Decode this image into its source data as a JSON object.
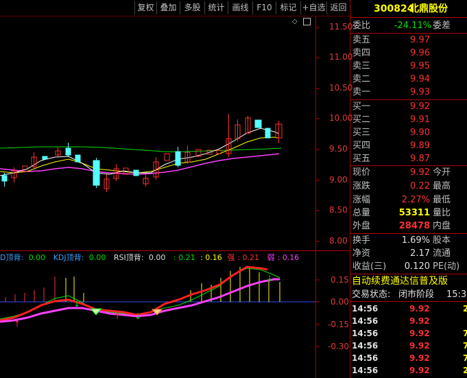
{
  "toolbar": {
    "buttons": [
      "复权",
      "叠加",
      "多股",
      "统计",
      "画线",
      "F10",
      "标记",
      "+自选",
      "返回"
    ]
  },
  "price_axis": {
    "labels": [
      "11.50",
      "11.00",
      "10.50",
      "10.00",
      "9.50",
      "9.00",
      "8.50",
      "8.00"
    ]
  },
  "indicator_axis": {
    "labels": [
      "0.15",
      "0.00",
      "-0.15",
      "-0.30"
    ]
  },
  "indicator": {
    "d_top_label": "D顶背:",
    "d_top_value": "0.00",
    "kdj_label": "KDJ顶背:",
    "kdj_value": "0.00",
    "rsi_label": "RSI顶背:",
    "rsi_value": "0.00",
    "v1": ": 0.21",
    "v2": ": 0.16",
    "strong_label": "强",
    "strong_value": ": 0.21",
    "weak_label": "弱",
    "weak_value": ": 0.16"
  },
  "stock": {
    "code": "300824",
    "name": "北鼎股份"
  },
  "order_book": {
    "ratio_label": "委比",
    "ratio_value": "-24.11%",
    "diff_label": "委差",
    "asks": [
      {
        "label": "卖五",
        "price": "9.97"
      },
      {
        "label": "卖四",
        "price": "9.96"
      },
      {
        "label": "卖三",
        "price": "9.95"
      },
      {
        "label": "卖二",
        "price": "9.94"
      },
      {
        "label": "卖一",
        "price": "9.93"
      }
    ],
    "bids": [
      {
        "label": "买一",
        "price": "9.92"
      },
      {
        "label": "买二",
        "price": "9.91"
      },
      {
        "label": "买三",
        "price": "9.90"
      },
      {
        "label": "买四",
        "price": "9.89"
      },
      {
        "label": "买五",
        "price": "9.87"
      }
    ]
  },
  "quote": {
    "rows": [
      {
        "label": "现价",
        "value": "9.92",
        "label2": "今开",
        "color": "red"
      },
      {
        "label": "涨跌",
        "value": "0.22",
        "label2": "最高",
        "color": "red"
      },
      {
        "label": "涨幅",
        "value": "2.27%",
        "label2": "最低",
        "color": "red"
      },
      {
        "label": "总量",
        "value": "53311",
        "label2": "量比",
        "color": "yel"
      },
      {
        "label": "外盘",
        "value": "28478",
        "label2": "内盘",
        "color": "red"
      }
    ],
    "rows2": [
      {
        "label": "换手",
        "value": "1.69%",
        "label2": "股本",
        "color": "wht"
      },
      {
        "label": "净资",
        "value": "2.17",
        "label2": "流通",
        "color": "wht"
      },
      {
        "label": "收益(三)",
        "value": "0.120",
        "label2": "PE(动)",
        "color": "wht"
      }
    ]
  },
  "banner": "自动续费通达信普及版",
  "trade_status": {
    "label": "交易状态:",
    "value": "闭市阶段",
    "time": "15:3"
  },
  "ticks": [
    {
      "time": "14:56",
      "price": "9.92",
      "vol": "2"
    },
    {
      "time": "14:56",
      "price": "9.92",
      "vol": ""
    },
    {
      "time": "14:56",
      "price": "9.92",
      "vol": "7"
    },
    {
      "time": "14:56",
      "price": "9.92",
      "vol": "7"
    },
    {
      "time": "14:56",
      "price": "9.92",
      "vol": "7"
    },
    {
      "time": "14:56",
      "price": "9.92",
      "vol": "2"
    }
  ],
  "colors": {
    "up": "#ff3030",
    "down": "#54ffff",
    "ma_short": "#ffffff",
    "ma_mid": "#ffff00",
    "ma_long": "#ff40ff",
    "ma_longest": "#00e000",
    "border": "#b00000"
  }
}
